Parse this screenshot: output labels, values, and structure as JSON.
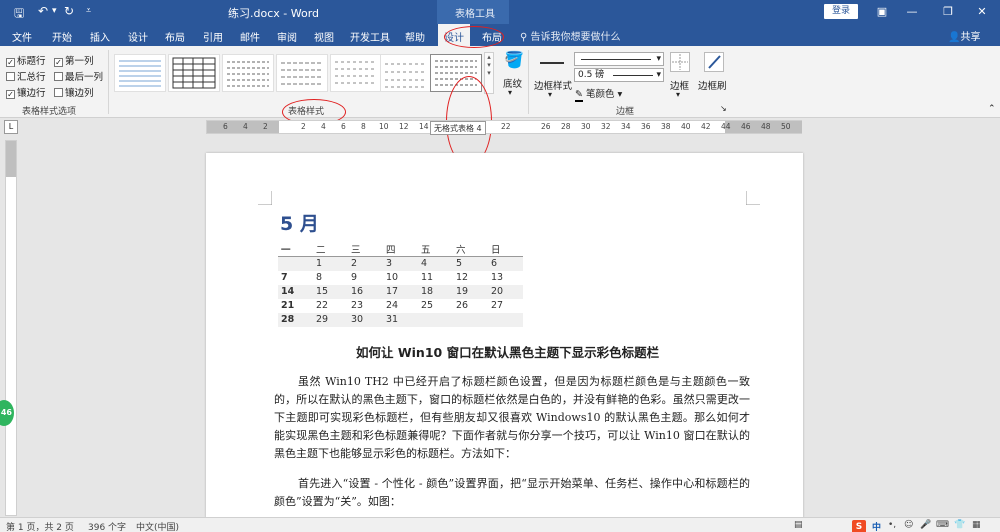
{
  "titlebar": {
    "save_icon": "save-icon",
    "undo_icon": "undo-icon",
    "redo_icon": "redo-icon",
    "customize_icon": "customize-icon",
    "doc_title": "练习.docx  -  Word",
    "context_label": "表格工具",
    "login": "登录",
    "ribbon_display_icon": "ribbon-display-icon",
    "minimize": "—",
    "restore": "❐",
    "close": "✕"
  },
  "tabs": {
    "items": [
      "文件",
      "开始",
      "插入",
      "设计",
      "布局",
      "引用",
      "邮件",
      "审阅",
      "视图",
      "开发工具",
      "帮助",
      "设计",
      "布局"
    ],
    "active_index": 11,
    "tellme": "告诉我你想要做什么",
    "share": "共享"
  },
  "ribbon": {
    "options": [
      {
        "label": "标题行",
        "checked": true
      },
      {
        "label": "第一列",
        "checked": true
      },
      {
        "label": "汇总行",
        "checked": false
      },
      {
        "label": "最后一列",
        "checked": false
      },
      {
        "label": "镶边行",
        "checked": true
      },
      {
        "label": "镶边列",
        "checked": false
      }
    ],
    "options_group": "表格样式选项",
    "styles_group": "表格样式",
    "shading": "底纹",
    "border_styles": "边框样式",
    "pen_weight": "0.5 磅",
    "pen_color": "笔颜色",
    "borders": "边框",
    "border_painter": "边框刷",
    "borders_group": "边框"
  },
  "ruler": {
    "numbers": [
      "6",
      "4",
      "2",
      "",
      "2",
      "4",
      "6",
      "8",
      "10",
      "12",
      "14",
      "",
      "",
      "22",
      "",
      "26",
      "28",
      "30",
      "32",
      "34",
      "36",
      "38",
      "40",
      "42",
      "44",
      "46",
      "48",
      "50"
    ],
    "tooltip": "无格式表格 4"
  },
  "document": {
    "heading": "5 月",
    "calendar": {
      "header": [
        "一",
        "二",
        "三",
        "四",
        "五",
        "六",
        "日"
      ],
      "rows": [
        [
          "",
          "1",
          "2",
          "3",
          "4",
          "5",
          "6"
        ],
        [
          "7",
          "8",
          "9",
          "10",
          "11",
          "12",
          "13"
        ],
        [
          "14",
          "15",
          "16",
          "17",
          "18",
          "19",
          "20"
        ],
        [
          "21",
          "22",
          "23",
          "24",
          "25",
          "26",
          "27"
        ],
        [
          "28",
          "29",
          "30",
          "31",
          "",
          "",
          ""
        ]
      ]
    },
    "article_title": "如何让 Win10 窗口在默认黑色主题下显示彩色标题栏",
    "para1": "虽然 Win10  TH2 中已经开启了标题栏颜色设置，但是因为标题栏颜色是与主题颜色一致的，所以在默认的黑色主题下，窗口的标题栏依然是白色的，并没有鲜艳的色彩。虽然只需更改一下主题即可实现彩色标题栏，但有些朋友却又很喜欢 Windows10 的默认黑色主题。那么如何才能实现黑色主题和彩色标题兼得呢？下面作者就与你分享一个技巧，可以让 Win10 窗口在默认的黑色主题下也能够显示彩色的标题栏。方法如下：",
    "para2": "首先进入“设置 - 个性化 - 颜色”设置界面，把“显示开始菜单、任务栏、操作中心和标题栏的颜色”设置为“关”。如图："
  },
  "statusbar": {
    "page": "第 1 页，共 2 页",
    "words": "396 个字",
    "lang": "中文(中国)",
    "ime": "中",
    "side_badge": "46"
  },
  "colors": {
    "word_blue": "#2b579a",
    "annotation_red": "#e02020"
  }
}
